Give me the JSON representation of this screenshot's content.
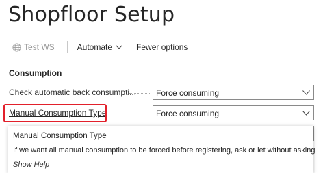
{
  "page": {
    "title": "Shopfloor Setup"
  },
  "toolbar": {
    "test_ws_label": "Test WS",
    "test_ws_icon": "globe-icon",
    "automate_label": "Automate",
    "automate_icon": "chevron-down-icon",
    "fewer_options_label": "Fewer options"
  },
  "section": {
    "title": "Consumption"
  },
  "fields": [
    {
      "label": "Check automatic back consumpti...",
      "value": "Force consuming"
    },
    {
      "label": "Manual Consumption Type",
      "value": "Force consuming"
    }
  ],
  "tooltip": {
    "title": "Manual Consumption Type",
    "body": "If we want all manual consumption to be forced before registering, ask or let without asking",
    "show_help": "Show Help"
  },
  "colors": {
    "highlight": "#e2202b",
    "disabled_text": "#9a9a9a"
  }
}
